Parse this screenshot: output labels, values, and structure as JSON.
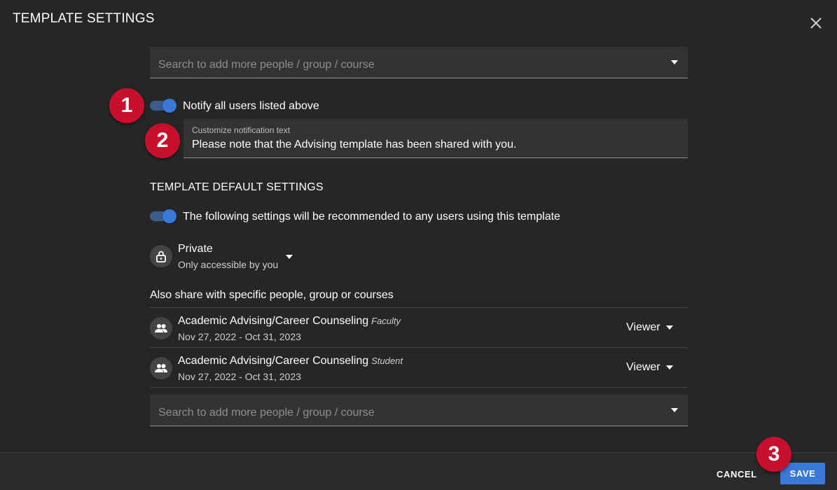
{
  "dialog": {
    "title": "TEMPLATE SETTINGS",
    "close_icon": "close-icon"
  },
  "top_search": {
    "placeholder": "Search to add more people / group / course"
  },
  "notify": {
    "toggle_on": true,
    "label": "Notify all users listed above",
    "field_label": "Customize notification text",
    "field_value": "Please note that the Advising template has been shared with you."
  },
  "defaults": {
    "heading": "TEMPLATE DEFAULT SETTINGS",
    "toggle_on": true,
    "toggle_label": "The following settings will be recommended to any users using this template"
  },
  "privacy": {
    "icon": "lock-icon",
    "title": "Private",
    "subtitle": "Only accessible by you"
  },
  "share": {
    "heading": "Also share with specific people, group or courses",
    "rows": [
      {
        "icon": "group-icon",
        "name": "Academic Advising/Career Counseling",
        "role": "Faculty",
        "dates": "Nov 27, 2022 - Oct 31, 2023",
        "permission": "Viewer"
      },
      {
        "icon": "group-icon",
        "name": "Academic Advising/Career Counseling",
        "role": "Student",
        "dates": "Nov 27, 2022 - Oct 31, 2023",
        "permission": "Viewer"
      }
    ]
  },
  "bottom_search": {
    "placeholder": "Search to add more people / group / course"
  },
  "badges": [
    "1",
    "2",
    "3"
  ],
  "footer": {
    "cancel_label": "CANCEL",
    "save_label": "SAVE"
  },
  "colors": {
    "background": "#262626",
    "accent": "#3a78d8",
    "badge": "#c8102e"
  }
}
